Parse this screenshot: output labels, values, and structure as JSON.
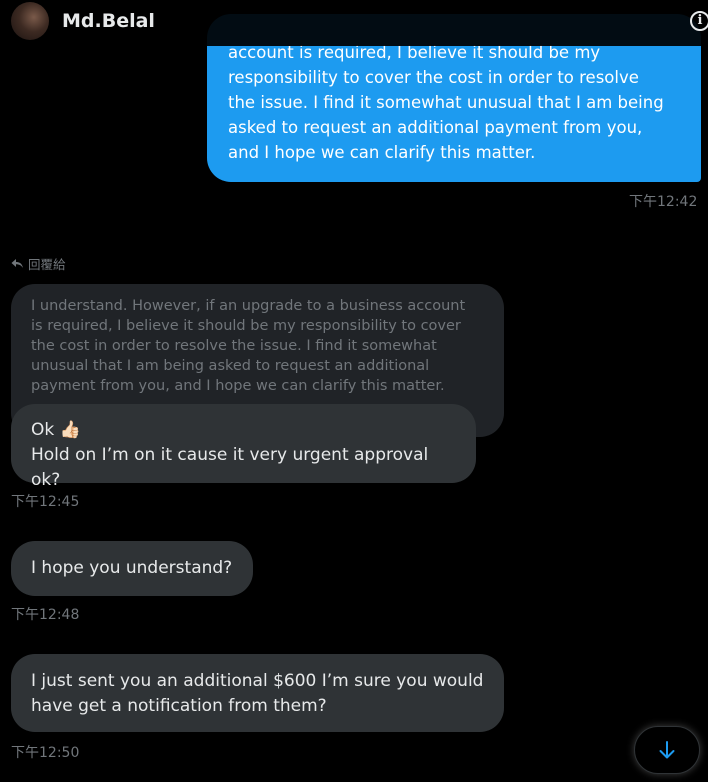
{
  "header": {
    "name": "Md.Belal",
    "info_icon": "info-icon",
    "avatar_icon": "avatar-photo"
  },
  "sent_message": {
    "lines": [
      "account is required, I believe it should be my",
      "responsibility to cover the cost in order to resolve",
      "the issue. I find it somewhat unusual that I am being",
      "asked to request an additional payment from you,",
      "and I hope we can clarify this matter."
    ],
    "time": "下午12:42",
    "color": "#1d9bf0"
  },
  "reply": {
    "label": "回覆給",
    "icon": "reply-arrow-icon",
    "quoted_lines": [
      "I understand. However, if an upgrade to a business account",
      "is required, I believe it should be my responsibility to cover",
      "the cost in order to resolve the issue. I find it somewhat",
      "unusual that I am being asked to request an additional",
      "payment from you, and I hope we can clarify this matter."
    ]
  },
  "messages": [
    {
      "line1": "Ok",
      "emoji": "👍🏻",
      "line2": "Hold on I’m on it cause it very urgent approval ok?",
      "time": "下午12:45"
    },
    {
      "text": "I hope you understand?",
      "time": "下午12:48"
    },
    {
      "line1": "I just sent you an additional $600 I’m sure you would",
      "line2": "have get a notification from them?",
      "time": "下午12:50"
    }
  ],
  "scroll_button_icon": "arrow-down-icon"
}
